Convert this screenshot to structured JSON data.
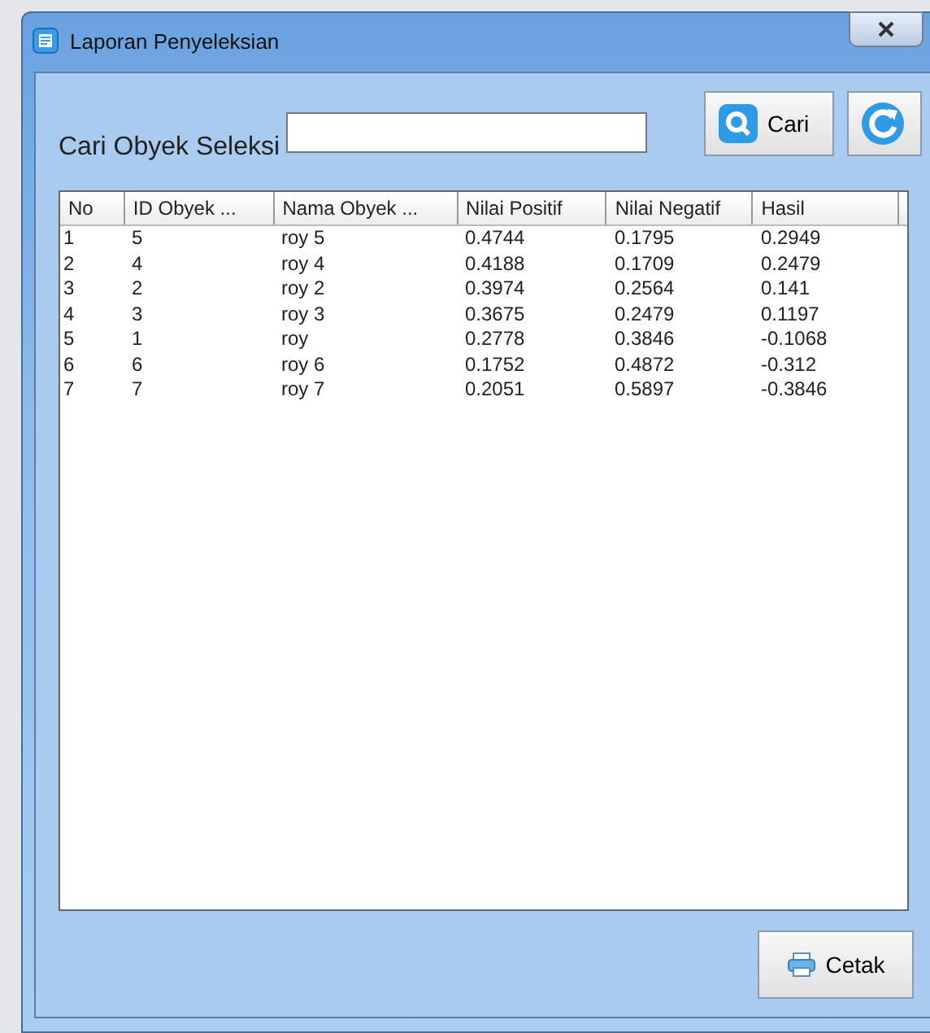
{
  "window": {
    "title": "Laporan Penyeleksian"
  },
  "search": {
    "label": "Cari Obyek Seleksi",
    "button": "Cari"
  },
  "table": {
    "columns": [
      "No",
      "ID Obyek ...",
      "Nama Obyek ...",
      "Nilai Positif",
      "Nilai Negatif",
      "Hasil"
    ],
    "rows": [
      [
        "1",
        "5",
        "roy 5",
        "0.4744",
        "0.1795",
        "0.2949"
      ],
      [
        "2",
        "4",
        "roy 4",
        "0.4188",
        "0.1709",
        "0.2479"
      ],
      [
        "3",
        "2",
        "roy 2",
        "0.3974",
        "0.2564",
        "0.141"
      ],
      [
        "4",
        "3",
        "roy 3",
        "0.3675",
        "0.2479",
        "0.1197"
      ],
      [
        "5",
        "1",
        "roy",
        "0.2778",
        "0.3846",
        "-0.1068"
      ],
      [
        "6",
        "6",
        "roy 6",
        "0.1752",
        "0.4872",
        "-0.312"
      ],
      [
        "7",
        "7",
        "roy 7",
        "0.2051",
        "0.5897",
        "-0.3846"
      ]
    ]
  },
  "print_button": "Cetak"
}
